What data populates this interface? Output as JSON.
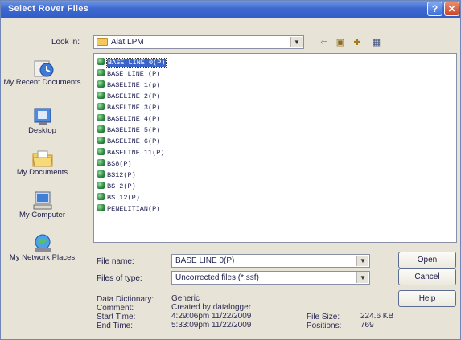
{
  "dialog": {
    "title": "Select Rover Files",
    "help_glyph": "?",
    "close_glyph": "✕"
  },
  "look_in": {
    "label": "Look in:",
    "value": "Alat LPM",
    "back_glyph": "⇦",
    "up_glyph": "▣",
    "new_folder_glyph": "✚",
    "view_glyph": "▦"
  },
  "places": [
    {
      "label": "My Recent Documents",
      "icon": "recent-documents-icon"
    },
    {
      "label": "Desktop",
      "icon": "desktop-icon"
    },
    {
      "label": "My Documents",
      "icon": "my-documents-icon"
    },
    {
      "label": "My Computer",
      "icon": "my-computer-icon"
    },
    {
      "label": "My Network Places",
      "icon": "network-places-icon"
    }
  ],
  "files": [
    "BASE LINE 0(P)",
    "BASE LINE (P)",
    "BASELINE 1(p)",
    "BASELINE 2(P)",
    "BASELINE 3(P)",
    "BASELINE 4(P)",
    "BASELINE 5(P)",
    "BASELINE 6(P)",
    "BASELINE 11(P)",
    "BS8(P)",
    "BS12(P)",
    "BS 2(P)",
    "BS 12(P)",
    "PENELITIAN(P)"
  ],
  "selected_file_index": 0,
  "file_name": {
    "label": "File name:",
    "value": "BASE LINE 0(P)"
  },
  "file_type": {
    "label": "Files of type:",
    "value": "Uncorrected files (*.ssf)"
  },
  "buttons": {
    "open": "Open",
    "cancel": "Cancel",
    "help": "Help"
  },
  "info": {
    "data_dictionary_label": "Data Dictionary:",
    "data_dictionary_value": "Generic",
    "comment_label": "Comment:",
    "comment_value": "Created by datalogger",
    "start_time_label": "Start Time:",
    "start_time_value": "4:29:06pm 11/22/2009",
    "end_time_label": "End Time:",
    "end_time_value": "5:33:09pm 11/22/2009",
    "file_size_label": "File Size:",
    "file_size_value": "224.6 KB",
    "positions_label": "Positions:",
    "positions_value": "769"
  }
}
